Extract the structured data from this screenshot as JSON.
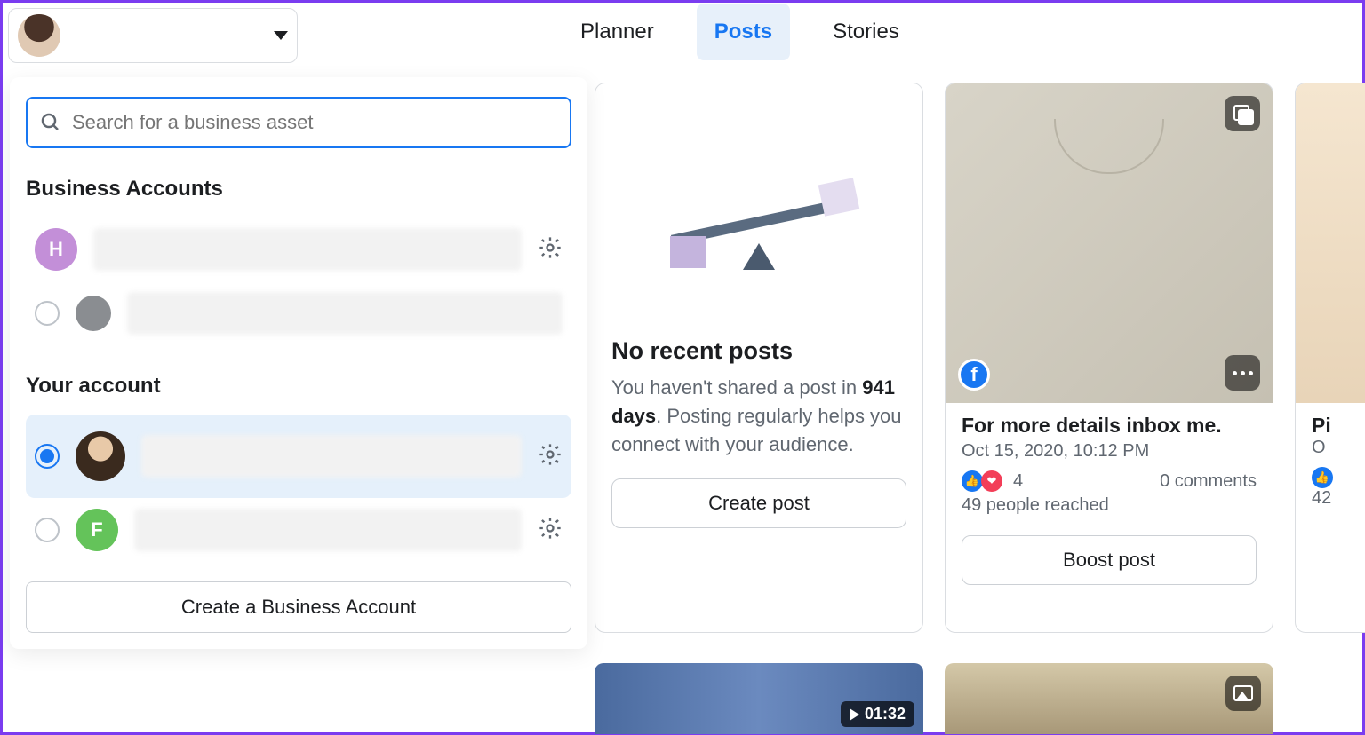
{
  "header": {
    "account_name": ""
  },
  "tabs": {
    "planner": "Planner",
    "posts": "Posts",
    "stories": "Stories"
  },
  "dropdown": {
    "search_placeholder": "Search for a business asset",
    "business_accounts_label": "Business Accounts",
    "your_account_label": "Your account",
    "business_accounts": [
      {
        "initial": "H",
        "color": "#c38fd8"
      }
    ],
    "your_accounts": [
      {
        "selected": true,
        "avatar": true
      },
      {
        "selected": false,
        "initial": "F",
        "color": "#64c35a"
      }
    ],
    "create_business_label": "Create a Business Account"
  },
  "no_posts_card": {
    "title": "No recent posts",
    "body_prefix": "You haven't shared a post in ",
    "days": "941 days",
    "body_suffix": ". Posting regularly helps you connect with your audience.",
    "button": "Create post"
  },
  "post_card_1": {
    "title": "For more details inbox me.",
    "date": "Oct 15, 2020, 10:12 PM",
    "reaction_count": "4",
    "comments": "0 comments",
    "reached": "49 people reached",
    "button": "Boost post"
  },
  "post_card_2": {
    "title_partial": "Pi",
    "date_partial": "O",
    "reached_partial": "42"
  },
  "video_thumb": {
    "duration": "01:32"
  }
}
